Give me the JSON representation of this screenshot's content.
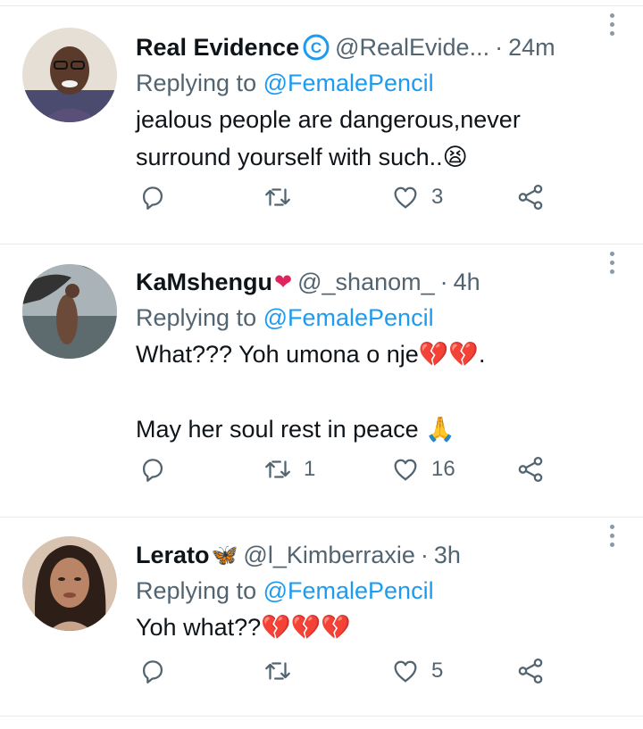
{
  "tweets": [
    {
      "name": "Real Evidence",
      "handle": "@RealEvide...",
      "separator": "·",
      "time": "24m",
      "replying_prefix": "Replying to ",
      "replying_to": "@FemalePencil",
      "text": "jealous people are dangerous,never surround yourself with such..😫",
      "reply_count": "",
      "retweet_count": "",
      "like_count": "3",
      "avatar_colors": [
        "#d9c7b4",
        "#3b2f3a"
      ]
    },
    {
      "name": "KaMshengu",
      "name_emoji": "❤",
      "handle": "@_shanom_",
      "separator": "·",
      "time": "4h",
      "replying_prefix": "Replying to ",
      "replying_to": "@FemalePencil",
      "text": "What??? Yoh umona o nje💔💔.\n\nMay her soul rest in peace 🙏",
      "reply_count": "",
      "retweet_count": "1",
      "like_count": "16",
      "avatar_colors": [
        "#9aa6ad",
        "#3a3c3a"
      ]
    },
    {
      "name": "Lerato",
      "name_emoji": "🦋",
      "handle": "@l_Kimberraxie",
      "separator": "·",
      "time": "3h",
      "replying_prefix": "Replying to ",
      "replying_to": "@FemalePencil",
      "text": "Yoh what??💔💔💔",
      "reply_count": "",
      "retweet_count": "",
      "like_count": "5",
      "avatar_colors": [
        "#c9a48d",
        "#2d1e18"
      ]
    }
  ],
  "colors": {
    "link": "#1d9bf0",
    "secondary": "#536471",
    "text": "#0f1419",
    "divider": "#e6ecf0"
  },
  "icons": [
    "reply-icon",
    "retweet-icon",
    "heart-icon",
    "share-icon",
    "more-icon",
    "verified-badge-icon"
  ]
}
